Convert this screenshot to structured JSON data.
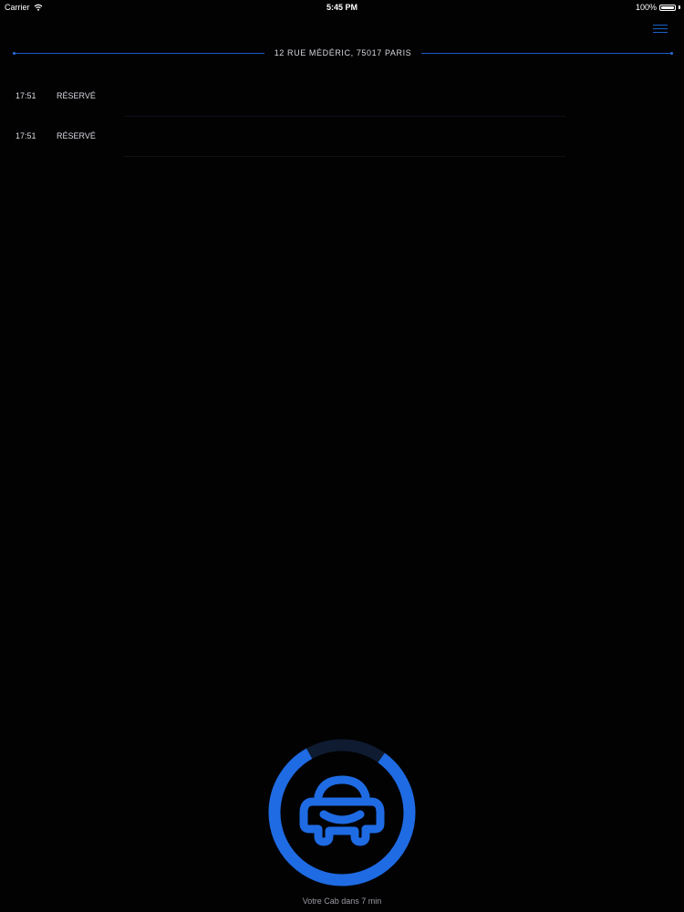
{
  "status_bar": {
    "carrier": "Carrier",
    "time": "5:45 PM",
    "battery": "100%"
  },
  "header": {
    "address": "12 RUE MÉDÉRIC, 75017 PARIS",
    "menu_icon": "hamburger-menu-icon"
  },
  "bookings": [
    {
      "time": "17:51",
      "status": "RÉSERVÉ"
    },
    {
      "time": "17:51",
      "status": "RÉSERVÉ"
    }
  ],
  "eta": {
    "label": "Votre Cab dans 7 min",
    "progress": 0.82,
    "icon": "car-icon"
  },
  "colors": {
    "background": "#020203",
    "accent": "#1f6be3",
    "ring_track": "#0f1b30"
  }
}
